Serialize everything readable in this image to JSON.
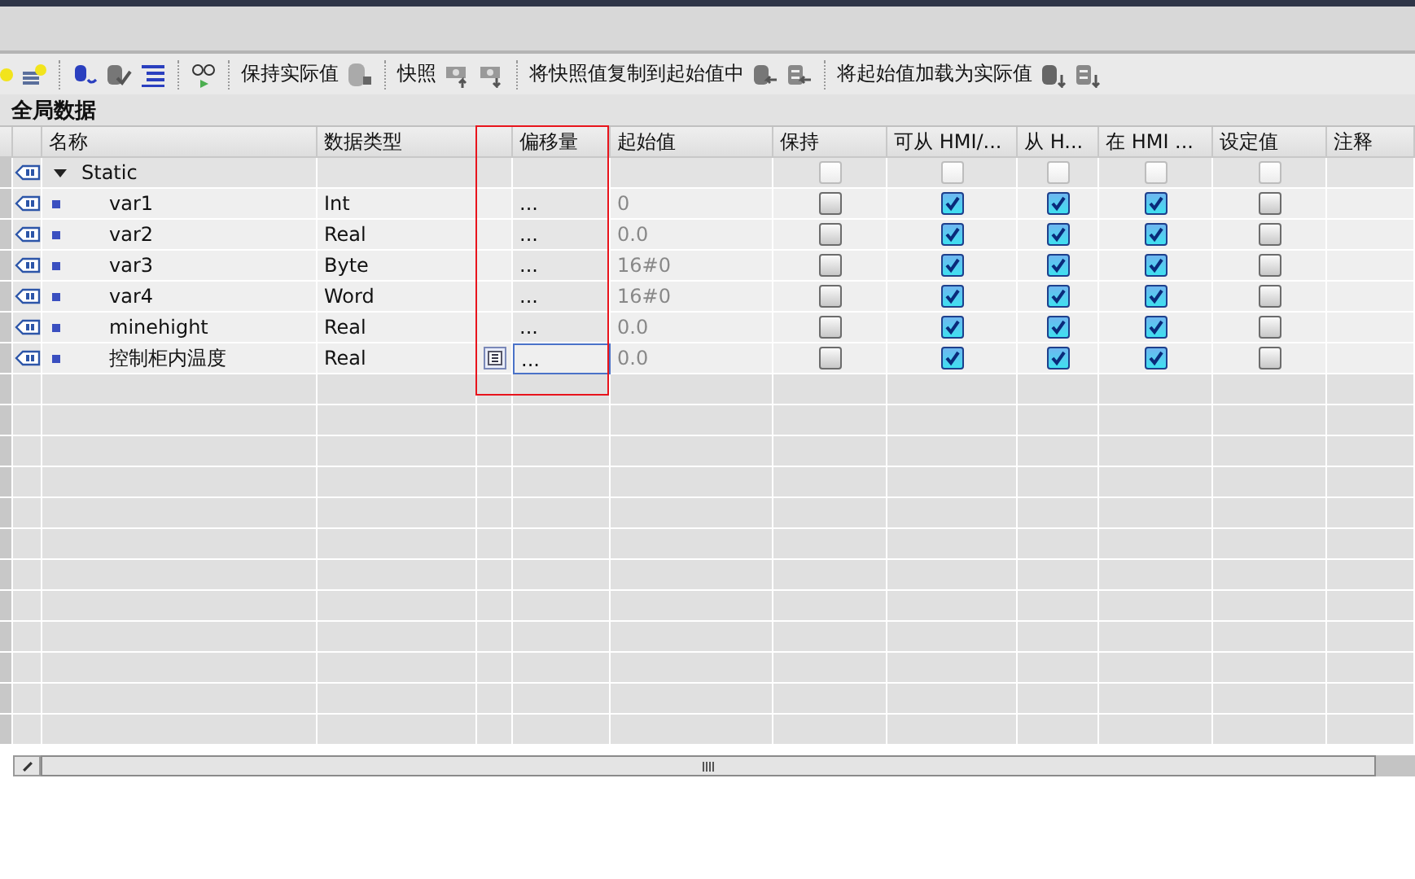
{
  "toolbar_labels": [
    "保持实际值",
    "快照",
    "将快照值复制到起始值中",
    "将起始值加载为实际值"
  ],
  "block_title": "全局数据",
  "columns": [
    {
      "label": "名称",
      "highlighted": false
    },
    {
      "label": "数据类型",
      "highlighted": false
    },
    {
      "highlighted": true
    },
    {
      "label": "偏移量",
      "highlighted": true
    },
    {
      "label": "起始值",
      "highlighted": false
    },
    {
      "label": "保持",
      "highlighted": false
    },
    {
      "label": "可从 HMI/...",
      "highlighted": false
    },
    {
      "label": "从 H...",
      "highlighted": false
    },
    {
      "label": "在 HMI ...",
      "highlighted": false
    },
    {
      "label": "设定值",
      "highlighted": false
    },
    {
      "label": "注释",
      "highlighted": false
    }
  ],
  "rows": [
    {
      "kind": "struct",
      "name": "Static",
      "expanded": true,
      "selected": false,
      "retain": false,
      "hmi_access": false,
      "hmi_visible": false,
      "hmi_writable": false,
      "setpoint": false
    },
    {
      "kind": "member",
      "name": "var1",
      "type": "Int",
      "offset": "...",
      "start": "0",
      "selected": false,
      "retain": false,
      "hmi_access": true,
      "hmi_visible": true,
      "hmi_writable": true,
      "setpoint": false
    },
    {
      "kind": "member",
      "name": "var2",
      "type": "Real",
      "offset": "...",
      "start": "0.0",
      "selected": false,
      "retain": false,
      "hmi_access": true,
      "hmi_visible": true,
      "hmi_writable": true,
      "setpoint": false
    },
    {
      "kind": "member",
      "name": "var3",
      "type": "Byte",
      "offset": "...",
      "start": "16#0",
      "selected": false,
      "retain": false,
      "hmi_access": true,
      "hmi_visible": true,
      "hmi_writable": true,
      "setpoint": false
    },
    {
      "kind": "member",
      "name": "var4",
      "type": "Word",
      "offset": "...",
      "start": "16#0",
      "selected": false,
      "retain": false,
      "hmi_access": true,
      "hmi_visible": true,
      "hmi_writable": true,
      "setpoint": false
    },
    {
      "kind": "member",
      "name": "minehight",
      "type": "Real",
      "offset": "...",
      "start": "0.0",
      "selected": false,
      "retain": false,
      "hmi_access": true,
      "hmi_visible": true,
      "hmi_writable": true,
      "setpoint": false
    },
    {
      "kind": "member",
      "name": "控制柜内温度",
      "type": "Real",
      "offset": "...",
      "start": "0.0",
      "selected": true,
      "retain": false,
      "hmi_access": true,
      "hmi_visible": true,
      "hmi_writable": true,
      "setpoint": false
    }
  ]
}
